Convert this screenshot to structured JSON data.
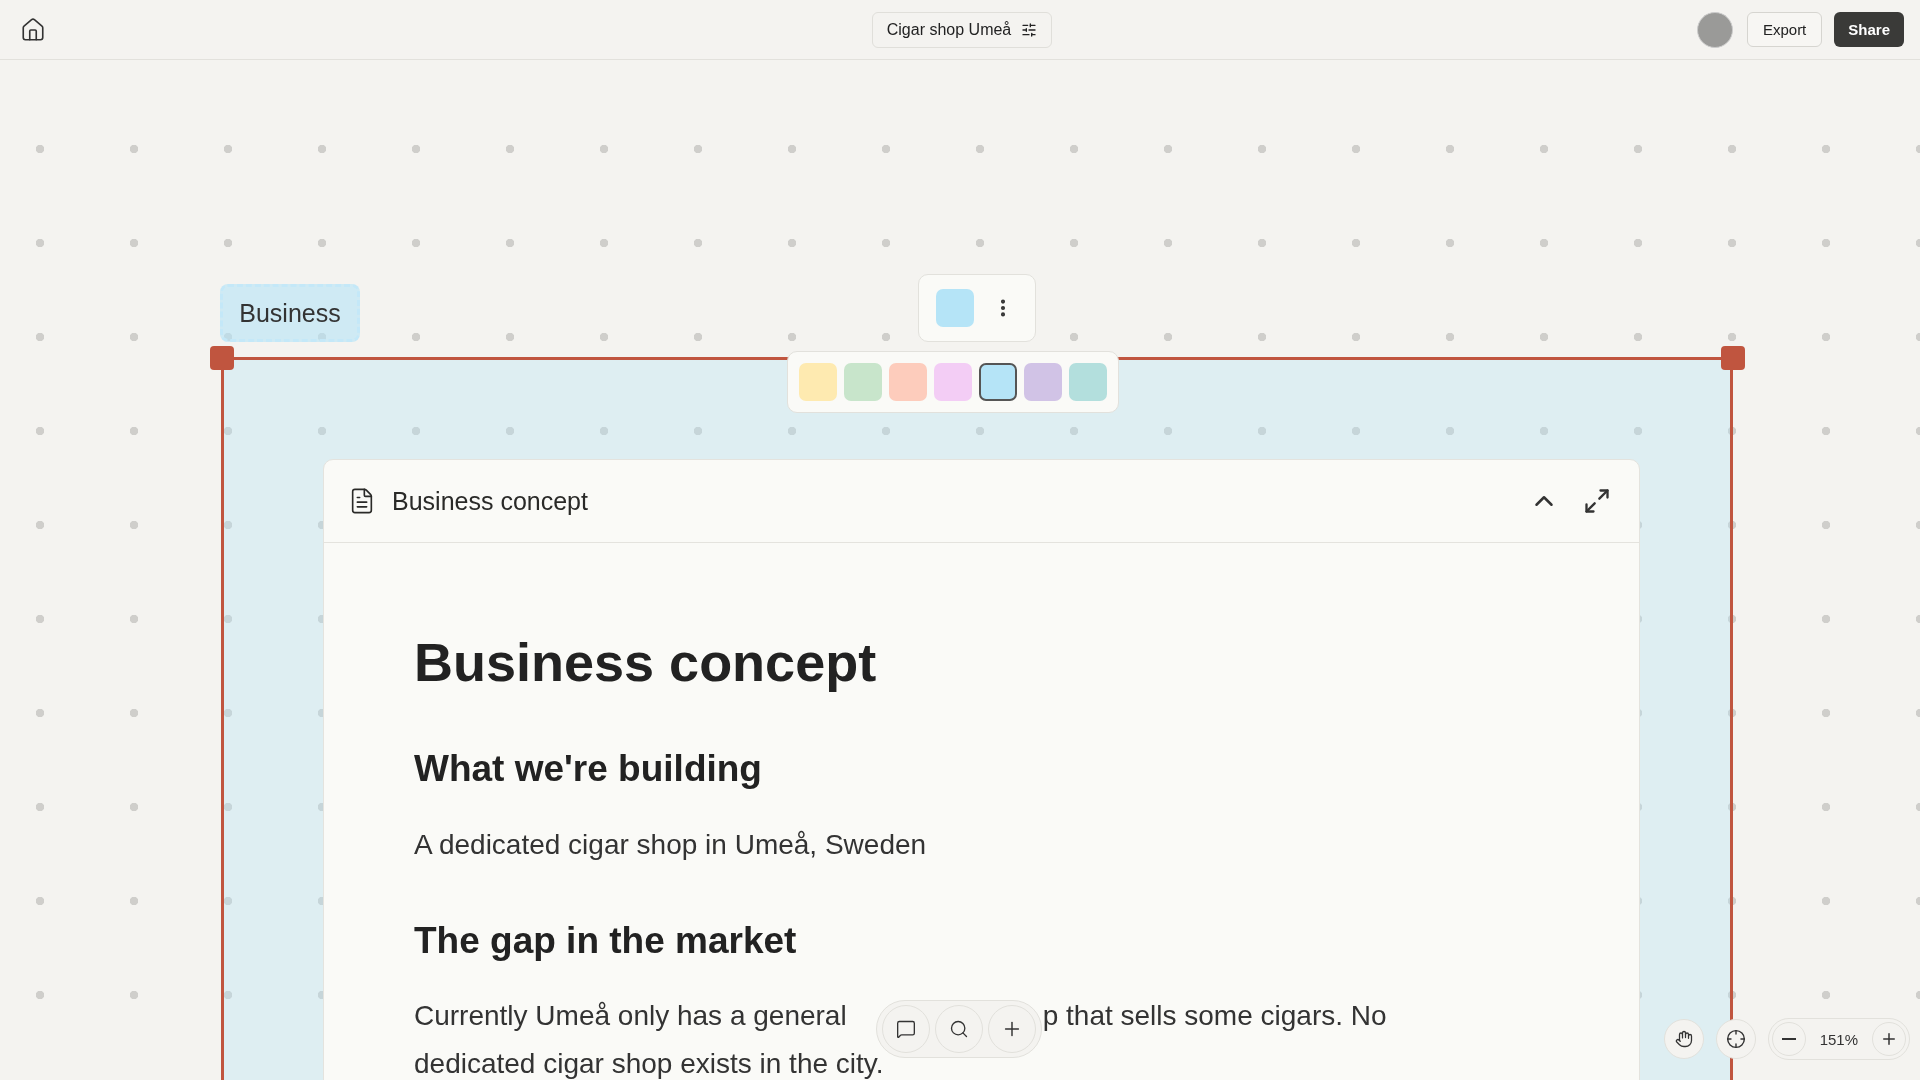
{
  "topbar": {
    "document_title": "Cigar shop Umeå",
    "buttons": [
      "Export",
      "Share"
    ]
  },
  "frame": {
    "label": "Business",
    "color_menu": {
      "colors": [
        {
          "color": "#feeab0",
          "selected": false
        },
        {
          "color": "#c8e5cb",
          "selected": false
        },
        {
          "color": "#fdccbc",
          "selected": false
        },
        {
          "color": "#f3cdf5",
          "selected": false
        },
        {
          "color": "#b5e4f7",
          "selected": true
        },
        {
          "color": "#d1c3e6",
          "selected": false
        },
        {
          "color": "#b3dfdd",
          "selected": false
        }
      ]
    }
  },
  "card": {
    "title": "Business concept",
    "expanded": true,
    "blocks": [
      {
        "kind": "h1",
        "text": "Business concept"
      },
      {
        "kind": "h2",
        "text": "What we're building"
      },
      {
        "kind": "p",
        "text": "A dedicated cigar shop in Umeå, Sweden"
      },
      {
        "kind": "h2",
        "text": "The gap in the market"
      },
      {
        "kind": "covered_p",
        "parts": [
          "Currently Umeå only has a general",
          "p that sells some cigars. No",
          "dedicated cigar shop exists in the city."
        ]
      }
    ]
  },
  "zoom": {
    "reading": "151%"
  }
}
